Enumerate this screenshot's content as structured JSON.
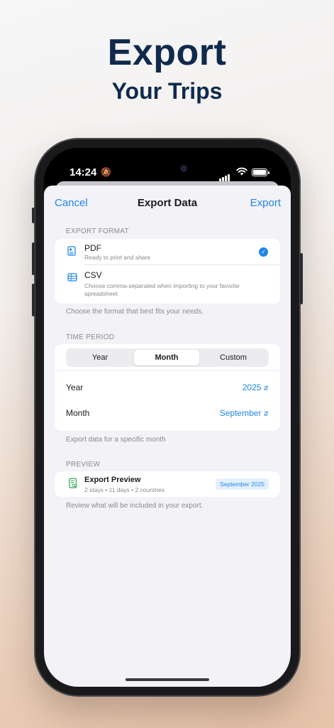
{
  "promo": {
    "title": "Export",
    "subtitle": "Your Trips"
  },
  "status_bar": {
    "time": "14:24",
    "bell_icon": "bell-slash-icon"
  },
  "nav": {
    "cancel": "Cancel",
    "title": "Export Data",
    "export": "Export"
  },
  "export_format": {
    "header": "EXPORT FORMAT",
    "options": [
      {
        "title": "PDF",
        "description": "Ready to print and share",
        "icon": "document-icon",
        "selected": true
      },
      {
        "title": "CSV",
        "description": "Choose comma-separated when importing to your favorite spreadsheet",
        "icon": "table-icon",
        "selected": false
      }
    ],
    "footer": "Choose the format that best fits your needs."
  },
  "time_period": {
    "header": "TIME PERIOD",
    "segments": [
      "Year",
      "Month",
      "Custom"
    ],
    "selected_segment": "Month",
    "rows": [
      {
        "label": "Year",
        "value": "2025"
      },
      {
        "label": "Month",
        "value": "September"
      }
    ],
    "footer": "Export data for a specific month"
  },
  "preview": {
    "header": "PREVIEW",
    "title": "Export Preview",
    "meta": "2 stays • 11 days • 2 countries",
    "badge": "September 2025",
    "footer": "Review what will be included in your export."
  },
  "colors": {
    "accent": "#1f86e6",
    "title_navy": "#0f2a4c",
    "preview_green": "#34a853"
  }
}
